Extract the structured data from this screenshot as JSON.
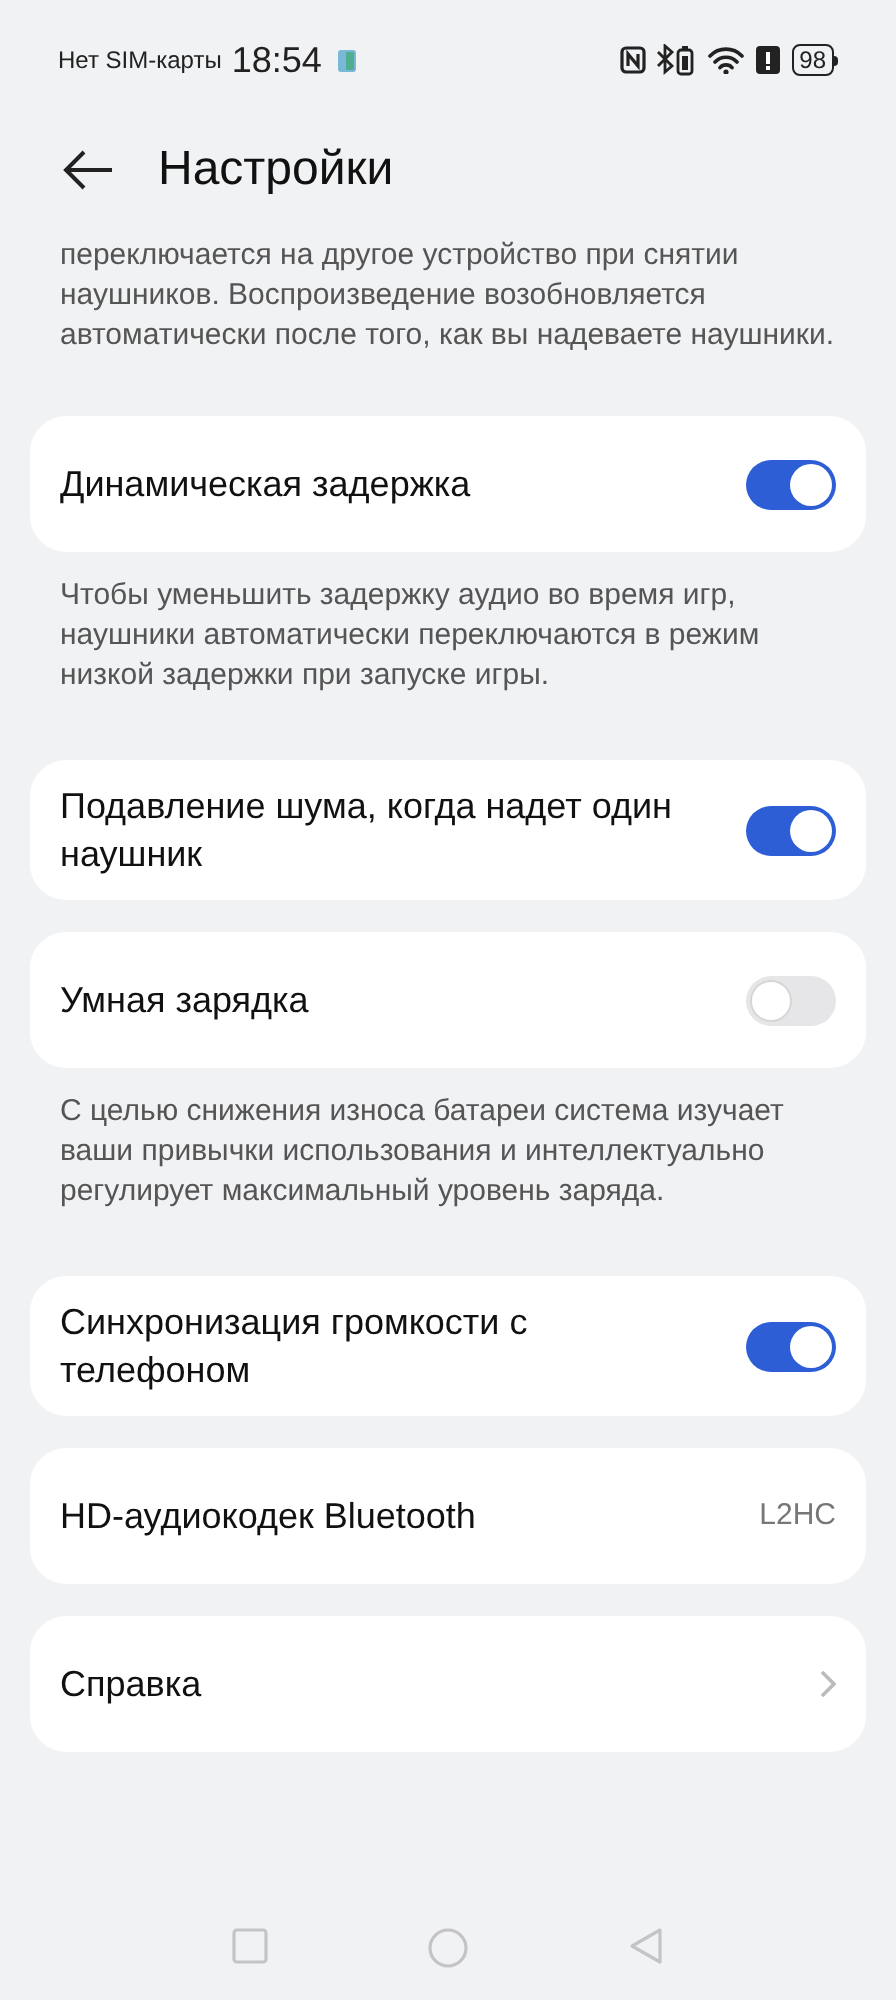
{
  "status_bar": {
    "carrier": "Нет SIM-карты",
    "time": "18:54",
    "battery": "98"
  },
  "header": {
    "title": "Настройки"
  },
  "content": [
    {
      "kind": "note",
      "text": "переключается на другое устройство при снятии наушников. Воспроизведение возобновляется автоматически после того, как вы надеваете наушники."
    },
    {
      "kind": "toggle",
      "label": "Динамическая задержка",
      "on": true
    },
    {
      "kind": "note",
      "text": "Чтобы уменьшить задержку аудио во время игр, наушники автоматически переключаются в режим низкой задержки при запуске игры."
    },
    {
      "kind": "toggle",
      "label": "Подавление шума, когда надет один наушник",
      "on": true
    },
    {
      "kind": "toggle",
      "label": "Умная зарядка",
      "on": false
    },
    {
      "kind": "note",
      "text": "С целью снижения износа батареи система изучает ваши привычки использования и интеллектуально регулирует максимальный уровень заряда."
    },
    {
      "kind": "toggle",
      "label": "Синхронизация громкости с телефоном",
      "on": true
    },
    {
      "kind": "value",
      "label": "HD-аудиокодек Bluetooth",
      "value": "L2HC"
    },
    {
      "kind": "link",
      "label": "Справка"
    }
  ]
}
